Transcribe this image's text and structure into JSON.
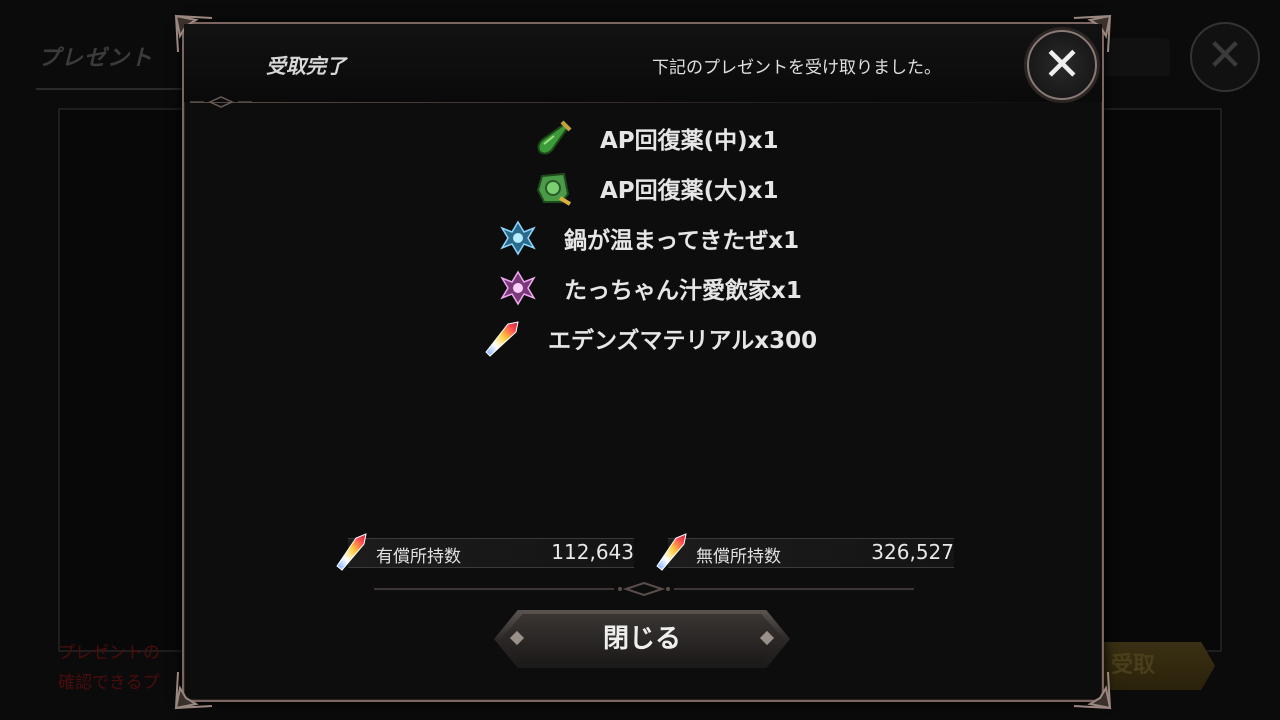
{
  "background": {
    "title": "プレゼント",
    "note_lines": [
      "プレゼントの",
      "確認できるプ"
    ],
    "receive_button": "受取",
    "close_glyph": "✕"
  },
  "dialog": {
    "title": "受取完了",
    "message": "下記のプレゼントを受け取りました。",
    "close_glyph": "✕",
    "items": [
      {
        "label": "AP回復薬(中)x1",
        "icon": "green-potion-bottle-icon"
      },
      {
        "label": "AP回復薬(大)x1",
        "icon": "green-potion-jar-icon"
      },
      {
        "label": "鍋が温まってきたぜx1",
        "icon": "blue-emblem-icon"
      },
      {
        "label": "たっちゃん汁愛飲家x1",
        "icon": "pink-emblem-icon"
      },
      {
        "label": "エデンズマテリアルx300",
        "icon": "rainbow-crystal-icon"
      }
    ],
    "paid_label": "有償所持数",
    "paid_value": "112,643",
    "free_label": "無償所持数",
    "free_value": "326,527",
    "close_button": "閉じる"
  }
}
